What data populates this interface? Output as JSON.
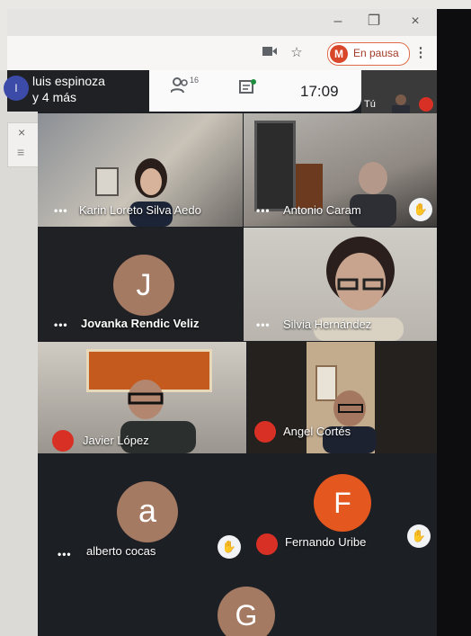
{
  "window": {
    "minimize": "–",
    "maximize": "❐",
    "close": "×"
  },
  "toolbar": {
    "camera_icon": "camera-icon",
    "star_icon": "star-icon",
    "profile_letter": "M",
    "profile_status": "En pausa",
    "menu": "⋮"
  },
  "side_panel": {
    "close": "×",
    "menu": "≡"
  },
  "meeting": {
    "title_line1": "luis espinoza",
    "title_line2": "y 4 más",
    "participant_count": "16",
    "time": "17:09",
    "self_label": "Tú"
  },
  "participants": [
    {
      "name": "Karin Loreto Silva Aedo"
    },
    {
      "name": "Antonio Caram"
    },
    {
      "name": "Jovanka Rendic Veliz",
      "initial": "J"
    },
    {
      "name": "Silvia Hernández"
    },
    {
      "name": "Javier López"
    },
    {
      "name": "Angel Cortés"
    },
    {
      "name": "alberto cocas",
      "initial": "a"
    },
    {
      "name": "Fernando Uribe",
      "initial": "F"
    },
    {
      "initial": "G"
    }
  ],
  "colors": {
    "accent_red": "#d93025",
    "avatar_tan": "#a57a63",
    "avatar_orange": "#e4571f"
  }
}
